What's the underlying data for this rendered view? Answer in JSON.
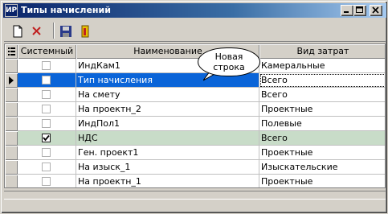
{
  "window": {
    "title": "Типы начислений",
    "icon_text": "ИР"
  },
  "toolbar": {
    "buttons": [
      {
        "name": "new-icon"
      },
      {
        "name": "delete-icon"
      },
      {
        "name": "save-icon"
      },
      {
        "name": "exit-icon"
      }
    ]
  },
  "grid": {
    "columns": [
      "Системный",
      "Наименование",
      "Вид затрат"
    ],
    "rows": [
      {
        "system": false,
        "name": "ИндКам1",
        "type": "Камеральные"
      },
      {
        "system": false,
        "name": "Тип начисления",
        "type": "Всего"
      },
      {
        "system": false,
        "name": "На смету",
        "type": "Всего"
      },
      {
        "system": false,
        "name": "На проектн_2",
        "type": "Проектные"
      },
      {
        "system": false,
        "name": "ИндПол1",
        "type": "Полевые"
      },
      {
        "system": true,
        "name": "НДС",
        "type": "Всего"
      },
      {
        "system": false,
        "name": "Ген. проект1",
        "type": "Проектные"
      },
      {
        "system": false,
        "name": "На изыск_1",
        "type": "Изыскательские"
      },
      {
        "system": false,
        "name": "На проектн_1",
        "type": "Проектные"
      }
    ],
    "selected_row": 1,
    "highlighted_row": 5
  },
  "tooltip": {
    "line1": "Новая",
    "line2": "строка"
  },
  "colors": {
    "title_start": "#0a246a",
    "title_end": "#a6caf0",
    "selection": "#0a64d8",
    "highlight": "#c8dcc8"
  }
}
